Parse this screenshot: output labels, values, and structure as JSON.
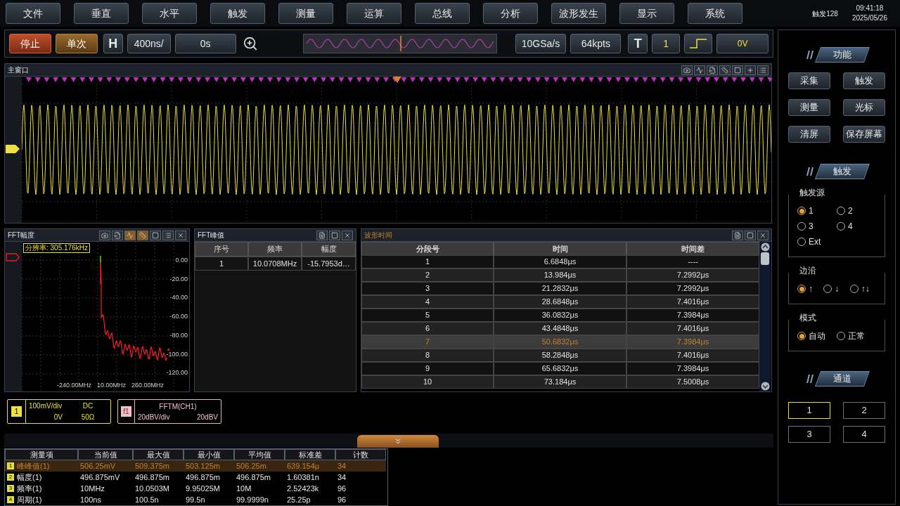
{
  "menu": [
    "文件",
    "垂直",
    "水平",
    "触发",
    "测量",
    "运算",
    "总线",
    "分析",
    "波形发生",
    "显示",
    "系统"
  ],
  "status": {
    "trigger_count": "触发128",
    "time": "09:41:18",
    "date": "2025/05/26"
  },
  "toolbar": {
    "run": "停止",
    "single": "单次",
    "h": "H",
    "timebase": "400ns/",
    "offset": "0s",
    "sample_rate": "10GSa/s",
    "memory": "64kpts",
    "t": "T",
    "trigger_source": "1",
    "trigger_level": "0V"
  },
  "main_window": {
    "title": "主窗口"
  },
  "fft_amplitude": {
    "title": "FFT幅度",
    "resolution": "分辨率: 305.176kHz",
    "tools": [
      {
        "kind": "camera",
        "selected": false
      },
      {
        "kind": "export",
        "selected": false
      },
      {
        "kind": "peak",
        "selected": true
      },
      {
        "kind": "marker",
        "selected": true
      },
      {
        "kind": "window",
        "selected": false
      },
      {
        "kind": "menu",
        "selected": false
      },
      {
        "kind": "close",
        "selected": false
      }
    ],
    "y_ticks": [
      "0.00",
      "-20.00",
      "-40.00",
      "-60.00",
      "-80.00",
      "-100.00",
      "-120.00"
    ],
    "x_labels": [
      "-240.00MHz",
      "10.00MHz",
      "260.00MHz"
    ]
  },
  "fft_peaks": {
    "title": "FFT峰值",
    "columns": [
      "序号",
      "频率",
      "幅度"
    ],
    "rows": [
      [
        "1",
        "10.0708MHz",
        "-15.7953d…"
      ]
    ]
  },
  "waveform_time": {
    "title": "波形时间",
    "columns": [
      "分段号",
      "时间",
      "时间差"
    ],
    "rows": [
      {
        "cells": [
          "1",
          "6.6848μs",
          "----"
        ],
        "selected": false
      },
      {
        "cells": [
          "2",
          "13.984μs",
          "7.2992μs"
        ],
        "selected": false
      },
      {
        "cells": [
          "3",
          "21.2832μs",
          "7.2992μs"
        ],
        "selected": false
      },
      {
        "cells": [
          "4",
          "28.6848μs",
          "7.4016μs"
        ],
        "selected": false
      },
      {
        "cells": [
          "5",
          "36.0832μs",
          "7.3984μs"
        ],
        "selected": false
      },
      {
        "cells": [
          "6",
          "43.4848μs",
          "7.4016μs"
        ],
        "selected": false
      },
      {
        "cells": [
          "7",
          "50.6832μs",
          "7.3984μs"
        ],
        "selected": true
      },
      {
        "cells": [
          "8",
          "58.2848μs",
          "7.4016μs"
        ],
        "selected": false
      },
      {
        "cells": [
          "9",
          "65.6832μs",
          "7.3984μs"
        ],
        "selected": false
      },
      {
        "cells": [
          "10",
          "73.184μs",
          "7.5008μs"
        ],
        "selected": false
      }
    ]
  },
  "channel_info": {
    "badge": "1",
    "scale": "100mV/div",
    "coupling": "DC",
    "offset": "0V",
    "impedance": "50Ω"
  },
  "math_info": {
    "badge": "f1",
    "name": "FFTM(CH1)",
    "scale": "20dBV/div",
    "offset": "20dBV"
  },
  "measurements": {
    "columns": [
      "测量项",
      "当前值",
      "最大值",
      "最小值",
      "平均值",
      "标准差",
      "计数"
    ],
    "rows": [
      {
        "badge": "1",
        "cells": [
          "峰峰值(1)",
          "506.25mV",
          "509.375m",
          "503.125m",
          "506.25m",
          "639.154μ",
          "34"
        ],
        "selected": true
      },
      {
        "badge": "2",
        "cells": [
          "幅度(1)",
          "496.875mV",
          "496.875m",
          "496.875m",
          "496.875m",
          "1.60381n",
          "34"
        ],
        "selected": false
      },
      {
        "badge": "3",
        "cells": [
          "频率(1)",
          "10MHz",
          "10.0503M",
          "9.95025M",
          "10M",
          "2.52423k",
          "96"
        ],
        "selected": false
      },
      {
        "badge": "4",
        "cells": [
          "周期(1)",
          "100ns",
          "100.5n",
          "99.5n",
          "99.9999n",
          "25.25p",
          "96"
        ],
        "selected": false
      }
    ]
  },
  "side_panel": {
    "function": {
      "title": "功能",
      "buttons": [
        "采集",
        "触发",
        "测量",
        "光标",
        "清屏",
        "保存屏幕"
      ]
    },
    "trigger": {
      "title": "触发",
      "groups": [
        {
          "title": "触发源",
          "options": [
            {
              "label": "1",
              "selected": true
            },
            {
              "label": "2",
              "selected": false
            },
            {
              "label": "3",
              "selected": false
            },
            {
              "label": "4",
              "selected": false
            },
            {
              "label": "Ext",
              "selected": false
            }
          ]
        },
        {
          "title": "边沿",
          "options": [
            {
              "label": "↑",
              "selected": true
            },
            {
              "label": "↓",
              "selected": false
            },
            {
              "label": "↑↓",
              "selected": false
            }
          ]
        },
        {
          "title": "模式",
          "options": [
            {
              "label": "自动",
              "selected": true
            },
            {
              "label": "正常",
              "selected": false
            }
          ]
        }
      ]
    },
    "channels": {
      "title": "通道",
      "items": [
        {
          "label": "1",
          "selected": true
        },
        {
          "label": "2",
          "selected": false
        },
        {
          "label": "3",
          "selected": false
        },
        {
          "label": "4",
          "selected": false
        }
      ]
    }
  }
}
